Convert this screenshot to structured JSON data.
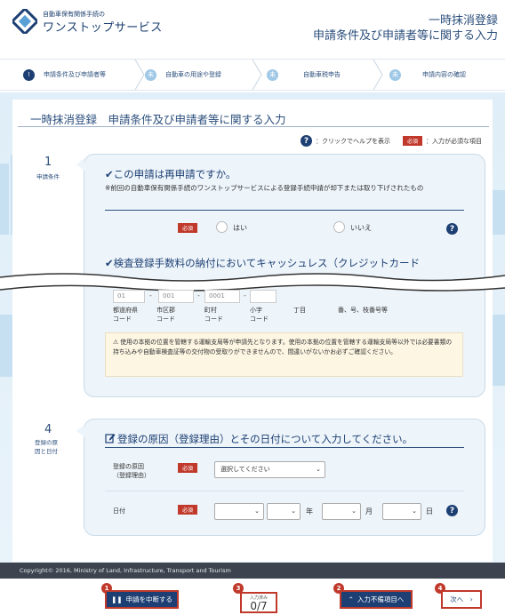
{
  "header": {
    "logo_small": "自動車保有関係手続の",
    "logo_big": "ワンストップサービス",
    "title_line1": "一時抹消登録",
    "title_line2": "申請条件及び申請者等に関する入力"
  },
  "steps": [
    {
      "label": "申請条件及び申請者等",
      "mark": "!"
    },
    {
      "label": "自動車の用途や登録",
      "mark": "未"
    },
    {
      "label": "自動車税申告",
      "mark": "未"
    },
    {
      "label": "申請内容の確認",
      "mark": "未"
    }
  ],
  "page_title": "一時抹消登録　申請条件及び申請者等に関する入力",
  "legend": {
    "help_icon": "?",
    "help_text": "：クリックでヘルプを表示",
    "required_badge": "必須",
    "required_text": "：入力が必須な項目"
  },
  "section1": {
    "number": "1",
    "label": "申請条件",
    "question": "✔この申請は再申請ですか。",
    "note": "※前回の自動車保有関係手続のワンストップサービスによる登録手続申請が却下または取り下げされたもの",
    "required": "必須",
    "option_yes": "はい",
    "option_no": "いいえ",
    "help_icon": "?",
    "question2": "✔検査登録手数料の納付においてキャッシュレス（クレジットカード"
  },
  "address": {
    "values": [
      "01",
      "001",
      "0001",
      ""
    ],
    "labels": [
      "都道府県\nコード",
      "市区郡\nコード",
      "町村\nコード",
      "小字\nコード",
      "丁目",
      "番、号、枝番号等"
    ]
  },
  "notice": "⚠ 使用の本拠の位置を管轄する運輸支局等が申請先となります。使用の本拠の位置を管轄する運輸支局等以外では必要書類の持ち込みや自動車検査証等の交付物の受取りができませんので、間違いがないかお必ずご確認ください。",
  "section4": {
    "number": "4",
    "label": "登録の原\n因と日付",
    "question": "登録の原因（登録理由）とその日付について入力してください。",
    "reason_label": "登録の原因\n（登録理由）",
    "required": "必須",
    "reason_select": "選択してください",
    "date_label": "日付",
    "unit_year": "年",
    "unit_month": "月",
    "unit_day": "日",
    "help_icon": "?"
  },
  "footer": {
    "copyright": "Copyright© 2016, Ministry of Land, Infrastructure, Transport and Tourism"
  },
  "bottom": {
    "suspend_button": "申請を中断する",
    "counter_label": "入力済み",
    "counter_value": "0/7",
    "incomplete_button": "入力不備項目へ",
    "next_button": "次へ　›",
    "markers": [
      "1",
      "3",
      "2",
      "4"
    ]
  }
}
